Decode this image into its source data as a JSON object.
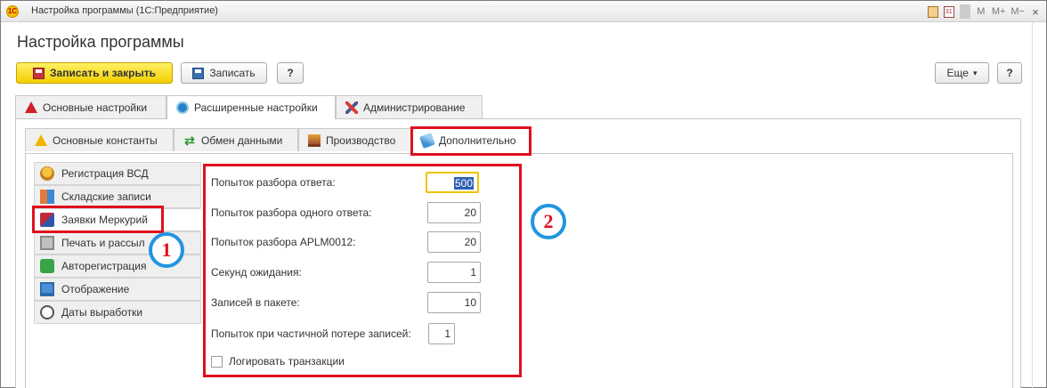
{
  "window": {
    "title": "Настройка программы (1С:Предприятие)",
    "logo": "1С"
  },
  "titlebar_icons": [
    "M",
    "M+",
    "M−",
    "×"
  ],
  "titlebar_cal_text": "31",
  "page_title": "Настройка программы",
  "toolbar": {
    "save_close_label": "Записать и закрыть",
    "save_label": "Записать",
    "help_label": "?",
    "more_label": "Еще",
    "more_arrow": "▾",
    "help_right_label": "?"
  },
  "tabs_top": [
    {
      "label": "Основные настройки",
      "icon": "warning-red-icon"
    },
    {
      "label": "Расширенные настройки",
      "icon": "extended-settings-icon"
    },
    {
      "label": "Администрирование",
      "icon": "admin-tools-icon"
    }
  ],
  "tabs_sub": [
    {
      "label": "Основные константы",
      "icon": "warning-yellow-icon"
    },
    {
      "label": "Обмен данными",
      "icon": "sync-icon"
    },
    {
      "label": "Производство",
      "icon": "factory-icon"
    },
    {
      "label": "Дополнительно",
      "icon": "brush-icon"
    }
  ],
  "sidebar": [
    {
      "label": "Регистрация ВСД",
      "icon": "medal-icon"
    },
    {
      "label": "Складские записи",
      "icon": "boxes-icon"
    },
    {
      "label": "Заявки Меркурий",
      "icon": "cube-icon"
    },
    {
      "label": "Печать и рассыл",
      "icon": "printer-icon"
    },
    {
      "label": "Авторегистрация",
      "icon": "check-icon"
    },
    {
      "label": "Отображение",
      "icon": "monitor-icon"
    },
    {
      "label": "Даты выработки",
      "icon": "clock-icon"
    }
  ],
  "form": {
    "fields": [
      {
        "label": "Попыток разбора ответа:",
        "value": "500"
      },
      {
        "label": "Попыток разбора одного ответа:",
        "value": "20"
      },
      {
        "label": "Попыток разбора APLM0012:",
        "value": "20"
      },
      {
        "label": "Секунд ожидания:",
        "value": "1"
      },
      {
        "label": "Записей в пакете:",
        "value": "10"
      },
      {
        "label": "Попыток при частичной потере записей:",
        "value": "1"
      }
    ],
    "checkbox_label": "Логировать транзакции",
    "checkbox_checked": false
  },
  "annotations": {
    "badge1": "1",
    "badge2": "2"
  },
  "colors": {
    "highlight": "#e0101e",
    "badge_ring": "#2196e0",
    "primary_button": "#f2cf00"
  }
}
